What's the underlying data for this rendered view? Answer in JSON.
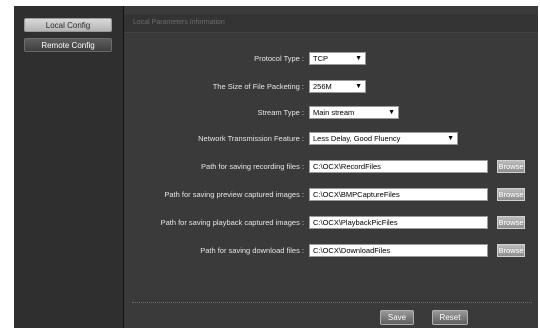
{
  "sidebar": {
    "items": [
      {
        "label": "Local Config"
      },
      {
        "label": "Remote Config"
      }
    ]
  },
  "panel": {
    "title": "Local Parameters Information"
  },
  "form": {
    "protocol_type": {
      "label": "Protocol Type :",
      "value": "TCP"
    },
    "file_packeting": {
      "label": "The Size of File Packeting :",
      "value": "256M"
    },
    "stream_type": {
      "label": "Stream Type :",
      "value": "Main stream"
    },
    "network_feature": {
      "label": "Network Transmission Feature :",
      "value": "Less Delay, Good Fluency"
    },
    "recording_path": {
      "label": "Path for saving recording files :",
      "value": "C:\\OCX\\RecordFiles"
    },
    "preview_path": {
      "label": "Path for saving preview captured images :",
      "value": "C:\\OCX\\BMPCaptureFiles"
    },
    "playback_path": {
      "label": "Path for saving playback captured images :",
      "value": "C:\\OCX\\PlaybackPicFiles"
    },
    "download_path": {
      "label": "Path for saving download files :",
      "value": "C:\\OCX\\DownloadFiles"
    },
    "browse_label": "Browse"
  },
  "actions": {
    "save": "Save",
    "reset": "Reset"
  }
}
